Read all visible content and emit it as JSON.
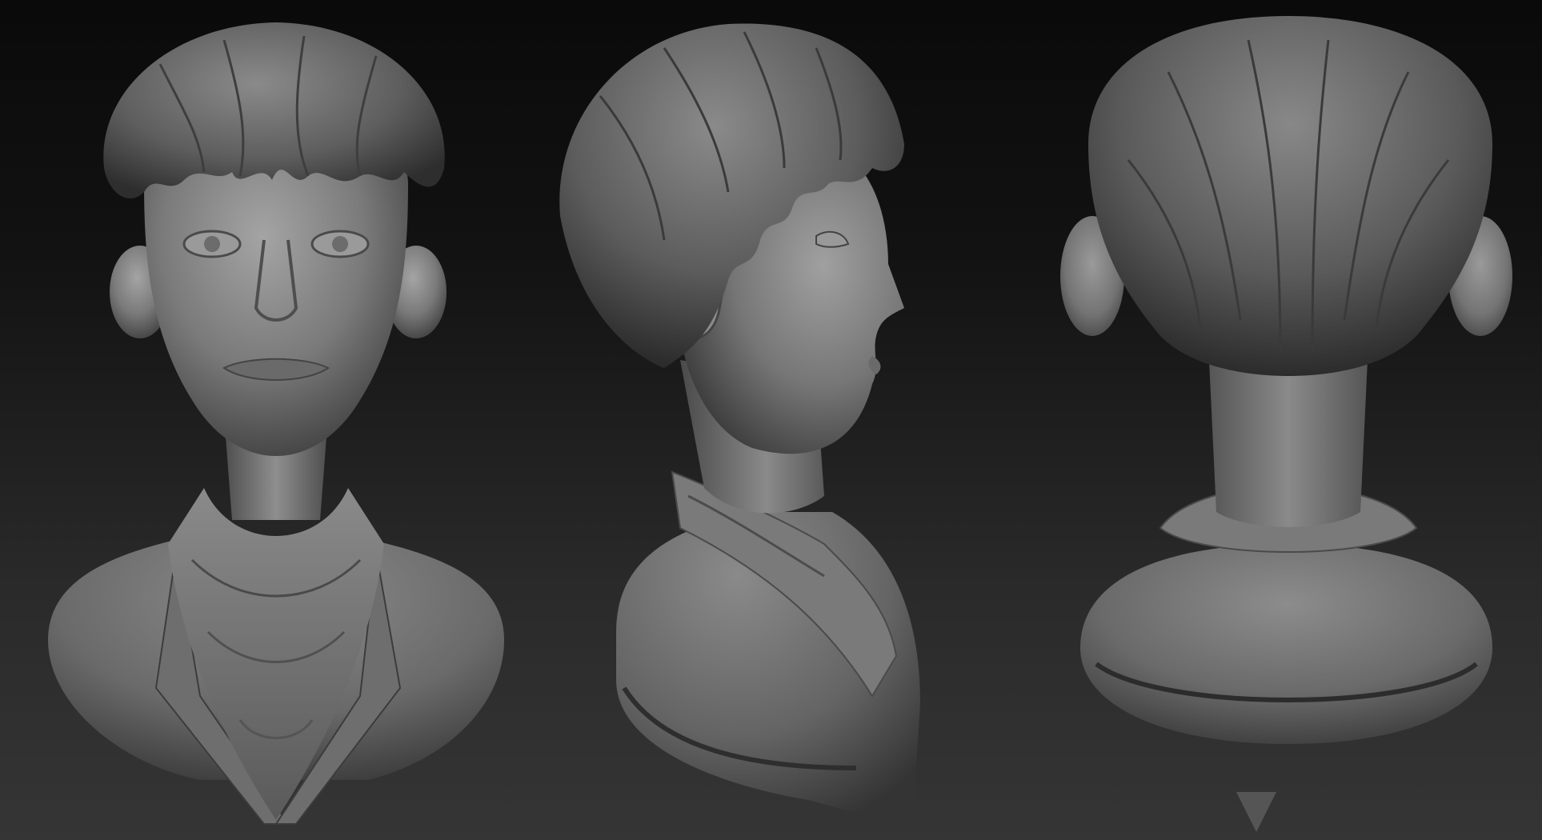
{
  "scene": {
    "background_top": "#0a0a0a",
    "background_bottom": "#353535",
    "material_color": "#7c7c7c",
    "views": [
      {
        "name": "front"
      },
      {
        "name": "side"
      },
      {
        "name": "back"
      }
    ]
  }
}
